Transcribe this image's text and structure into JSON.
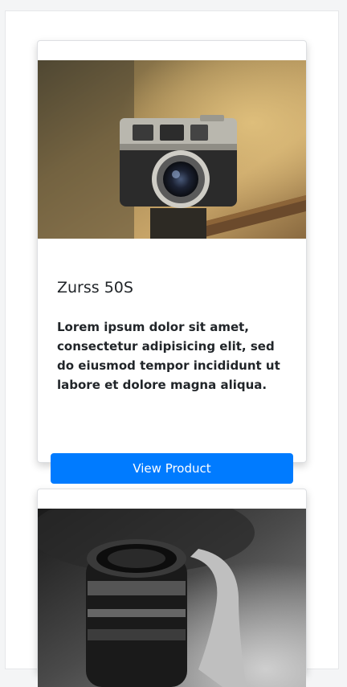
{
  "products": [
    {
      "title": "Zurss 50S",
      "description": "Lorem ipsum dolor sit amet, consectetur adipisicing elit, sed do eiusmod tempor incididunt ut labore et dolore magna aliqua.",
      "button_label": "View Product",
      "image": "vintage-camera-photo"
    },
    {
      "image": "camera-lens-bw-photo"
    }
  ],
  "colors": {
    "primary": "#007bff",
    "page_background": "#f4f5f6",
    "card_background": "#ffffff",
    "text": "#212529"
  }
}
